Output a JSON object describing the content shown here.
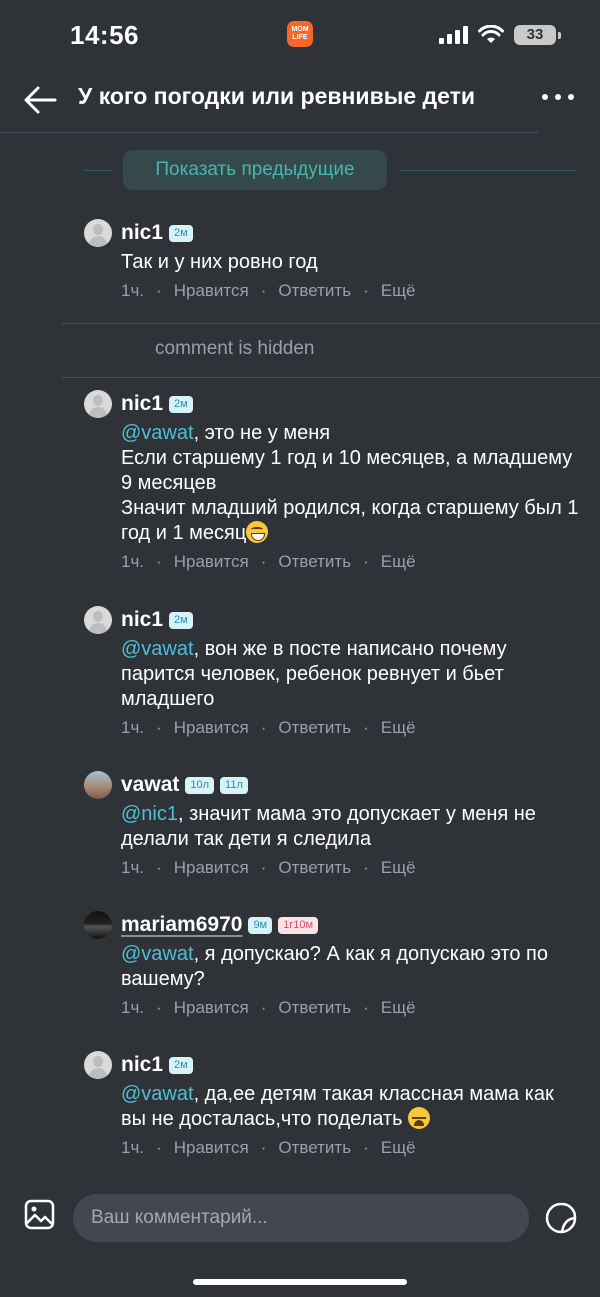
{
  "status_bar": {
    "time": "14:56",
    "app_badge": "MOM LIFE",
    "battery": "33"
  },
  "header": {
    "title": "У кого погодки или ревнивые дети"
  },
  "show_previous": "Показать предыдущие",
  "hidden_comment": "comment is hidden",
  "actions": {
    "like": "Нравится",
    "reply": "Ответить",
    "more": "Ещё",
    "separator": "·"
  },
  "comments": [
    {
      "user": "nic1",
      "badges": [
        "2м"
      ],
      "mention": "",
      "text": "Так и у них ровно год",
      "emoji": "",
      "time": "1ч."
    },
    {
      "user": "nic1",
      "badges": [
        "2м"
      ],
      "mention": "@vawat",
      "text": ", это не у меня\nЕсли старшему 1 год и 10 месяцев, а младшему 9 месяцев\nЗначит младший родился, когда старшему был 1 год и 1 месяц",
      "emoji": "grinning-face",
      "time": "1ч."
    },
    {
      "user": "nic1",
      "badges": [
        "2м"
      ],
      "mention": "@vawat",
      "text": ", вон же в посте написано почему парится человек, ребенок ревнует и бьет младшего",
      "emoji": "",
      "time": "1ч."
    },
    {
      "user": "vawat",
      "badges": [
        "10л",
        "11л"
      ],
      "mention": "@nic1",
      "text": ", значит мама это допускает у меня не делали так дети я следила",
      "emoji": "",
      "time": "1ч."
    },
    {
      "user": "mariam6970",
      "badges": [
        "9м",
        "1г10м"
      ],
      "mention": "@vawat",
      "text": ", я допускаю? А как я допускаю это по вашему?",
      "emoji": "",
      "time": "1ч."
    },
    {
      "user": "nic1",
      "badges": [
        "2м"
      ],
      "mention": "@vawat",
      "text": ", да,ее детям такая классная мама как вы не досталась,что поделать ",
      "emoji": "weary-face",
      "time": "1ч."
    }
  ],
  "input": {
    "placeholder": "Ваш комментарий..."
  },
  "colors": {
    "background": "#2f3237",
    "accent": "#44b8ae",
    "mention": "#4dc0d7",
    "muted": "#9aa0a6"
  }
}
